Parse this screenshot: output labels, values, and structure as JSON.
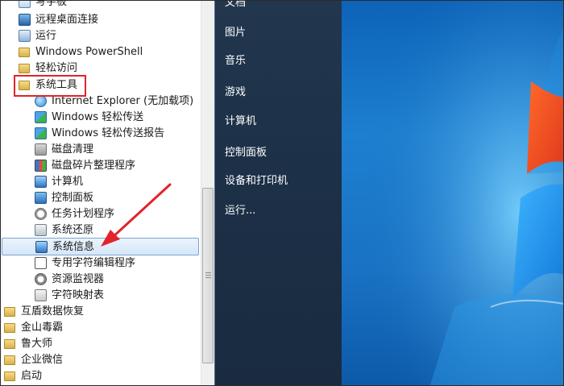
{
  "program_list": {
    "items": [
      {
        "label": "写字板",
        "icon": "wordpad-icon"
      },
      {
        "label": "远程桌面连接",
        "icon": "remote-desktop-icon"
      },
      {
        "label": "运行",
        "icon": "run-icon"
      },
      {
        "label": "Windows PowerShell",
        "icon": "folder-icon"
      },
      {
        "label": "轻松访问",
        "icon": "folder-icon"
      },
      {
        "label": "系统工具",
        "icon": "folder-icon"
      },
      {
        "label": "Internet Explorer (无加载项)",
        "icon": "internet-explorer-icon"
      },
      {
        "label": "Windows 轻松传送",
        "icon": "easy-transfer-icon"
      },
      {
        "label": "Windows 轻松传送报告",
        "icon": "easy-transfer-reports-icon"
      },
      {
        "label": "磁盘清理",
        "icon": "disk-cleanup-icon"
      },
      {
        "label": "磁盘碎片整理程序",
        "icon": "disk-defragmenter-icon"
      },
      {
        "label": "计算机",
        "icon": "computer-icon"
      },
      {
        "label": "控制面板",
        "icon": "control-panel-icon"
      },
      {
        "label": "任务计划程序",
        "icon": "task-scheduler-icon"
      },
      {
        "label": "系统还原",
        "icon": "system-restore-icon"
      },
      {
        "label": "系统信息",
        "icon": "system-information-icon"
      },
      {
        "label": "专用字符编辑程序",
        "icon": "private-character-editor-icon"
      },
      {
        "label": "资源监视器",
        "icon": "resource-monitor-icon"
      },
      {
        "label": "字符映射表",
        "icon": "character-map-icon"
      },
      {
        "label": "互盾数据恢复",
        "icon": "folder-icon"
      },
      {
        "label": "金山毒霸",
        "icon": "folder-icon"
      },
      {
        "label": "鲁大师",
        "icon": "folder-icon"
      },
      {
        "label": "企业微信",
        "icon": "folder-icon"
      },
      {
        "label": "启动",
        "icon": "folder-icon"
      }
    ]
  },
  "start_menu_right": {
    "items": [
      "文档",
      "图片",
      "音乐",
      "游戏",
      "计算机",
      "控制面板",
      "设备和打印机",
      "运行..."
    ]
  },
  "colors": {
    "highlight_border": "#e2232b",
    "selection": "#d5e7f8",
    "annotation_arrow": "#e2232b",
    "start_panel": "#1c3047"
  }
}
